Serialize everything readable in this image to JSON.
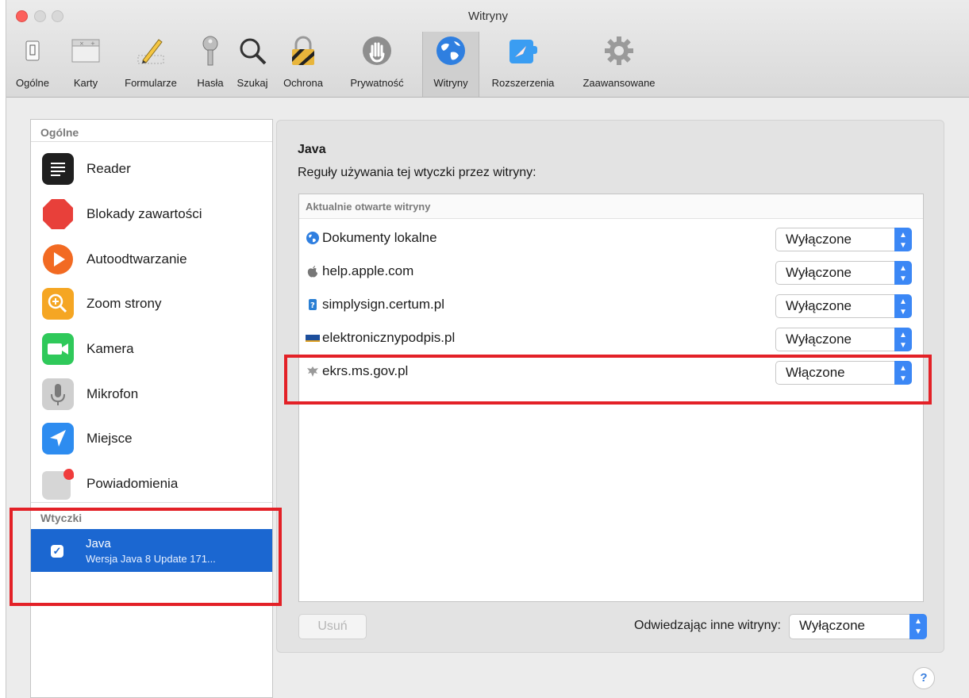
{
  "window": {
    "title": "Witryny"
  },
  "toolbar": {
    "items": [
      {
        "label": "Ogólne",
        "icon": "switch-icon"
      },
      {
        "label": "Karty",
        "icon": "tabs-icon"
      },
      {
        "label": "Formularze",
        "icon": "pencil-icon"
      },
      {
        "label": "Hasła",
        "icon": "key-icon"
      },
      {
        "label": "Szukaj",
        "icon": "search-icon"
      },
      {
        "label": "Ochrona",
        "icon": "lock-icon"
      },
      {
        "label": "Prywatność",
        "icon": "hand-icon"
      },
      {
        "label": "Witryny",
        "icon": "globe-icon"
      },
      {
        "label": "Rozszerzenia",
        "icon": "extension-icon"
      },
      {
        "label": "Zaawansowane",
        "icon": "gear-icon"
      }
    ],
    "active": "Witryny"
  },
  "sidebar": {
    "general_header": "Ogólne",
    "items": [
      {
        "label": "Reader",
        "icon": "reader-icon",
        "color": "#1f1f1f"
      },
      {
        "label": "Blokady zawartości",
        "icon": "stop-icon",
        "color": "#e8403a"
      },
      {
        "label": "Autoodtwarzanie",
        "icon": "play-icon",
        "color": "#f26a22"
      },
      {
        "label": "Zoom strony",
        "icon": "zoom-icon",
        "color": "#f5a623"
      },
      {
        "label": "Kamera",
        "icon": "camera-icon",
        "color": "#2fc95a"
      },
      {
        "label": "Mikrofon",
        "icon": "microphone-icon",
        "color": "#c9c9c9"
      },
      {
        "label": "Miejsce",
        "icon": "location-icon",
        "color": "#2d8cf0"
      },
      {
        "label": "Powiadomienia",
        "icon": "notifications-icon",
        "color": "#d6d6d6"
      }
    ],
    "plugins_header": "Wtyczki",
    "plugin": {
      "name": "Java",
      "version": "Wersja Java 8 Update 171..."
    }
  },
  "panel": {
    "title": "Java",
    "subtitle": "Reguły używania tej wtyczki przez witryny:",
    "table_header": "Aktualnie otwarte witryny",
    "rows": [
      {
        "site": "Dokumenty lokalne",
        "icon": "globe-icon",
        "value": "Wyłączone"
      },
      {
        "site": "help.apple.com",
        "icon": "apple-icon",
        "value": "Wyłączone"
      },
      {
        "site": "simplysign.certum.pl",
        "icon": "certum-icon",
        "value": "Wyłączone"
      },
      {
        "site": "elektronicznypodpis.pl",
        "icon": "kir-icon",
        "value": "Wyłączone"
      },
      {
        "site": "ekrs.ms.gov.pl",
        "icon": "eagle-icon",
        "value": "Włączone"
      }
    ],
    "remove_button": "Usuń",
    "other_sites_label": "Odwiedzając inne witryny:",
    "other_sites_value": "Wyłączone"
  },
  "help": "?",
  "colors": {
    "accent": "#1b67d1",
    "highlight": "#e32127"
  }
}
